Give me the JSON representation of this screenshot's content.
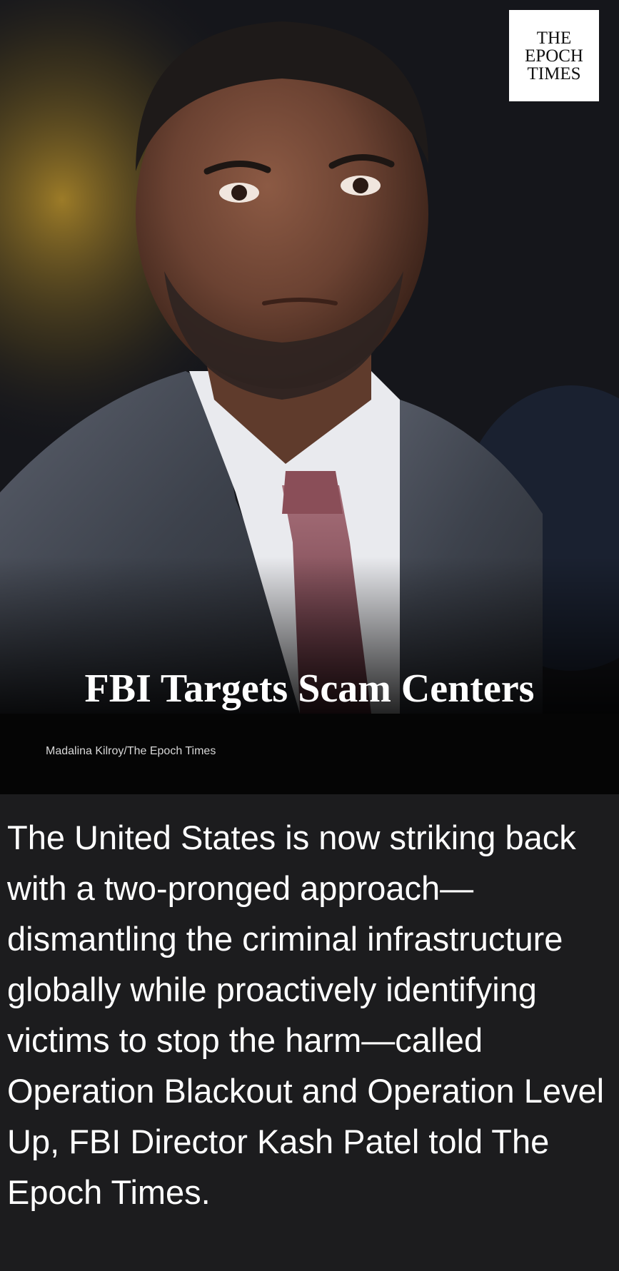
{
  "photo": {
    "subject": "portrait-photo"
  },
  "logo": {
    "line1": "THE",
    "line2": "EPOCH",
    "line3": "TIMES"
  },
  "headline": "FBI Targets Scam Centers",
  "caption": "Madalina Kilroy/The Epoch Times",
  "body": "The United States is now striking back with a two-pronged approach—dismantling the criminal infrastructure globally while proactively identifying victims to stop the harm—called Operation Blackout and Operation Level Up, FBI Director Kash Patel told The Epoch Times.",
  "colors": {
    "background": "#1c1c1e",
    "caption_band": "#050505",
    "text": "#ffffff"
  }
}
